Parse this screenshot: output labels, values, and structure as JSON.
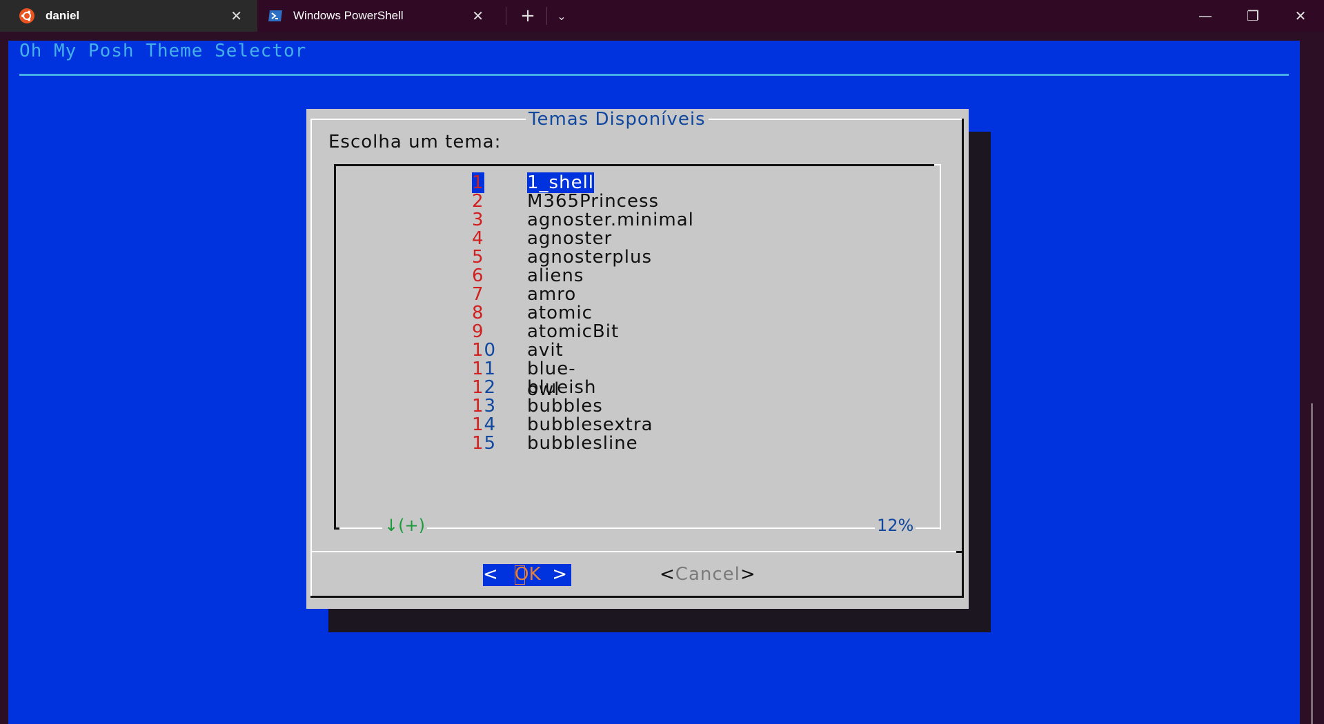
{
  "tabs": [
    {
      "title": "daniel",
      "icon": "ubuntu-icon",
      "active": true
    },
    {
      "title": "Windows PowerShell",
      "icon": "powershell-icon",
      "active": false
    }
  ],
  "titlebar": {
    "new_tab": "+",
    "dropdown": "⌄",
    "minimize": "—",
    "maximize": "❐",
    "close": "✕",
    "tab_close": "✕"
  },
  "terminal": {
    "title": "Oh My Posh Theme Selector"
  },
  "dialog": {
    "title": "Temas Disponíveis",
    "prompt": "Escolha um tema:",
    "items": [
      {
        "num": "1",
        "name": "1_shell"
      },
      {
        "num": "2",
        "name": "M365Princess"
      },
      {
        "num": "3",
        "name": "agnoster.minimal"
      },
      {
        "num": "4",
        "name": "agnoster"
      },
      {
        "num": "5",
        "name": "agnosterplus"
      },
      {
        "num": "6",
        "name": "aliens"
      },
      {
        "num": "7",
        "name": "amro"
      },
      {
        "num": "8",
        "name": "atomic"
      },
      {
        "num": "9",
        "name": "atomicBit"
      },
      {
        "num": "10",
        "name": "avit"
      },
      {
        "num": "11",
        "name": "blue-owl"
      },
      {
        "num": "12",
        "name": "blueish"
      },
      {
        "num": "13",
        "name": "bubbles"
      },
      {
        "num": "14",
        "name": "bubblesextra"
      },
      {
        "num": "15",
        "name": "bubblesline"
      }
    ],
    "selected_index": 0,
    "scroll_hint": "↓(+)",
    "scroll_percent": "12%",
    "ok_label": "OK",
    "ok_left": "<",
    "ok_right": ">",
    "cancel_label": "Cancel",
    "cancel_left": "<",
    "cancel_right": ">"
  },
  "colors": {
    "terminal_bg": "#0033dd",
    "dialog_bg": "#c8c8c8",
    "title_color": "#45b0e8",
    "number_color": "#d02020",
    "accent": "#e08040"
  }
}
